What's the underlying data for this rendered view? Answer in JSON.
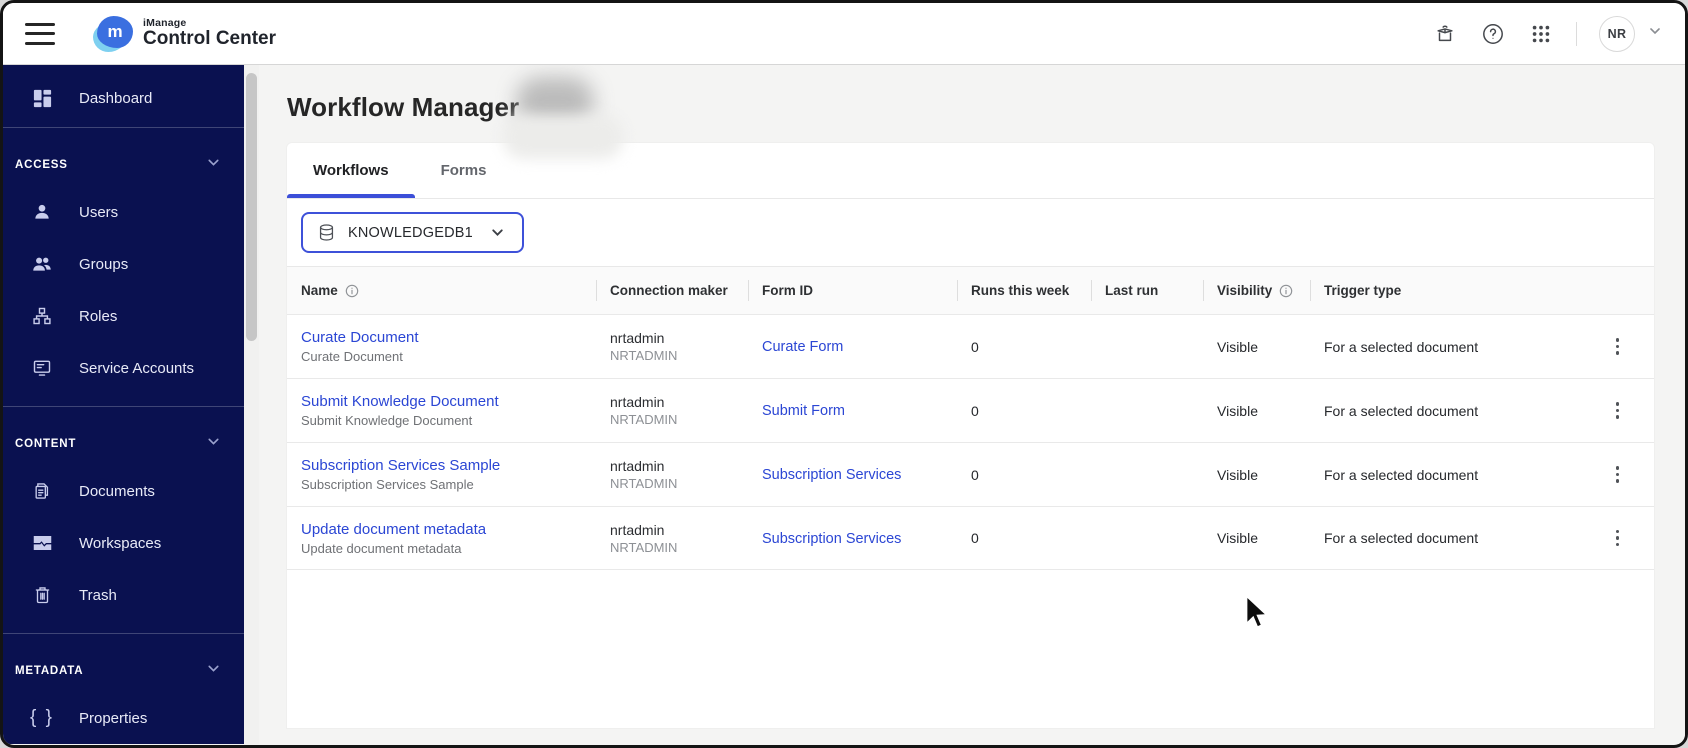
{
  "colors": {
    "sidebar_navy": "#0a1150",
    "accent_blue": "#3c4fd8",
    "link_blue": "#2b46d4",
    "main_bg": "#f4f4f3"
  },
  "header": {
    "product": "iManage",
    "app": "Control Center",
    "avatar_initials": "NR"
  },
  "sidebar": {
    "dashboard_label": "Dashboard",
    "sections": [
      {
        "label": "ACCESS",
        "items": [
          {
            "label": "Users"
          },
          {
            "label": "Groups"
          },
          {
            "label": "Roles"
          },
          {
            "label": "Service Accounts"
          }
        ]
      },
      {
        "label": "CONTENT",
        "items": [
          {
            "label": "Documents"
          },
          {
            "label": "Workspaces"
          },
          {
            "label": "Trash"
          }
        ]
      },
      {
        "label": "METADATA",
        "items": [
          {
            "label": "Properties"
          }
        ]
      }
    ]
  },
  "main": {
    "title": "Workflow Manager",
    "tabs": [
      {
        "label": "Workflows"
      },
      {
        "label": "Forms"
      }
    ],
    "library_selector": {
      "value": "KNOWLEDGEDB1"
    },
    "table": {
      "columns": [
        {
          "label": "Name"
        },
        {
          "label": "Connection maker"
        },
        {
          "label": "Form ID"
        },
        {
          "label": "Runs this week"
        },
        {
          "label": "Last run"
        },
        {
          "label": "Visibility"
        },
        {
          "label": "Trigger type"
        }
      ],
      "rows": [
        {
          "name": "Curate Document",
          "subtitle": "Curate Document",
          "maker": "nrtadmin",
          "maker_org": "NRTADMIN",
          "form_id": "Curate Form",
          "runs": "0",
          "last_run": "",
          "visibility": "Visible",
          "trigger": "For a selected document"
        },
        {
          "name": "Submit Knowledge Document",
          "subtitle": "Submit Knowledge Document",
          "maker": "nrtadmin",
          "maker_org": "NRTADMIN",
          "form_id": "Submit Form",
          "runs": "0",
          "last_run": "",
          "visibility": "Visible",
          "trigger": "For a selected document"
        },
        {
          "name": "Subscription Services Sample",
          "subtitle": "Subscription Services Sample",
          "maker": "nrtadmin",
          "maker_org": "NRTADMIN",
          "form_id": "Subscription Services",
          "runs": "0",
          "last_run": "",
          "visibility": "Visible",
          "trigger": "For a selected document"
        },
        {
          "name": "Update document metadata",
          "subtitle": "Update document metadata",
          "maker": "nrtadmin",
          "maker_org": "NRTADMIN",
          "form_id": "Subscription Services",
          "runs": "0",
          "last_run": "",
          "visibility": "Visible",
          "trigger": "For a selected document"
        }
      ]
    }
  }
}
